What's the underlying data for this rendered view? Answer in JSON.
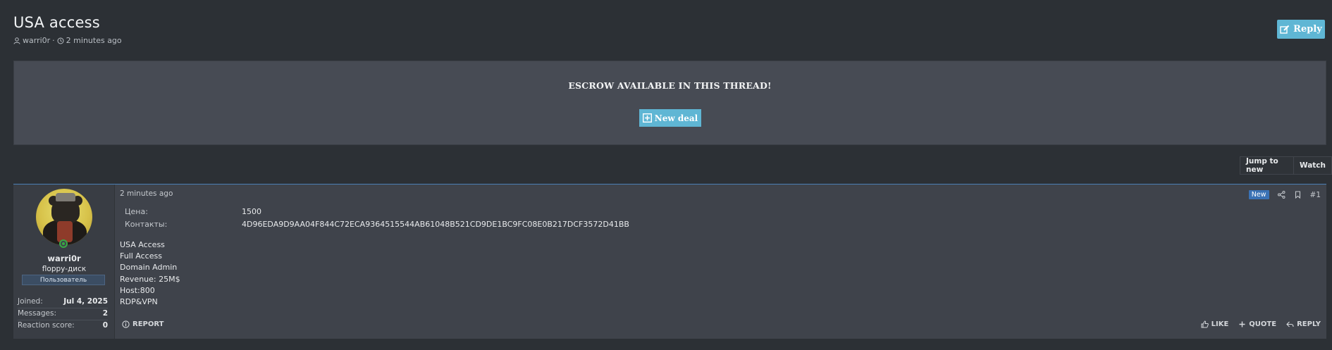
{
  "thread": {
    "title": "USA access",
    "author": "warri0r",
    "separator": "·",
    "time_ago": "2 minutes ago",
    "reply_label": "Reply"
  },
  "escrow": {
    "title": "ESCROW AVAILABLE IN THIS THREAD!",
    "new_deal_label": "New deal"
  },
  "nav": {
    "jump_to_new": "Jump to new",
    "watch": "Watch"
  },
  "post": {
    "user": {
      "name": "warri0r",
      "title": "floppy-диск",
      "banner": "Пользователь",
      "stats": [
        {
          "key": "Joined:",
          "value": "Jul 4, 2025"
        },
        {
          "key": "Messages:",
          "value": "2"
        },
        {
          "key": "Reaction score:",
          "value": "0"
        }
      ]
    },
    "time": "2 minutes ago",
    "badge": "New",
    "number": "#1",
    "fields": [
      {
        "key": "Цена:",
        "value": "1500"
      },
      {
        "key": "Контакты:",
        "value": "4D96EDA9D9AA04F844C72ECA9364515544AB61048B521CD9DE1BC9FC08E0B217DCF3572D41BB"
      }
    ],
    "lines": [
      "USA Access",
      "Full Access",
      "Domain Admin",
      "Revenue: 25M$",
      "Host:800",
      "RDP&VPN"
    ],
    "footer": {
      "report": "REPORT",
      "like": "LIKE",
      "quote": "QUOTE",
      "reply": "REPLY"
    }
  },
  "colors": {
    "background": "#2c3035",
    "accent": "#5fb6d4",
    "badge": "#3a72b5",
    "online": "#39a845"
  }
}
